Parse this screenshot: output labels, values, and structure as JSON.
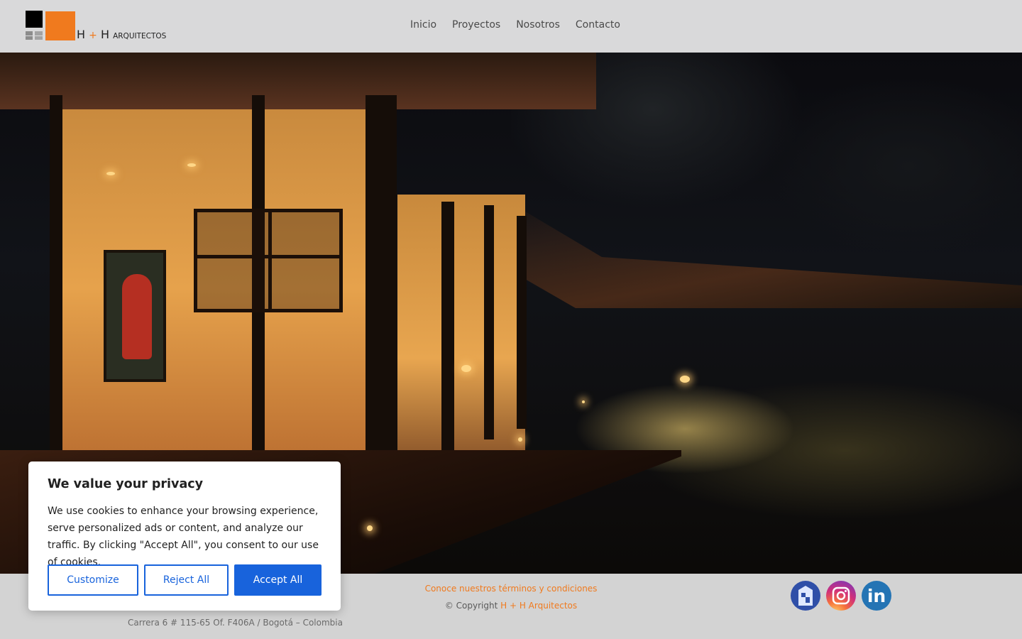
{
  "brand": {
    "logo_main": "H",
    "logo_plus": "+",
    "logo_second": "H",
    "logo_sub": "ARQUITECTOS",
    "accent_color": "#f07a1e"
  },
  "nav": {
    "items": [
      {
        "label": "Inicio"
      },
      {
        "label": "Proyectos"
      },
      {
        "label": "Nosotros"
      },
      {
        "label": "Contacto"
      }
    ]
  },
  "hero": {
    "image_icon": "house-at-night-photo"
  },
  "footer": {
    "terms_link": "Conoce nuestros términos y condiciones",
    "copyright_prefix": "© Copyright",
    "copyright_brand": "H + H Arquitectos",
    "address": "Carrera 6 # 115-65 Of. F406A / Bogotá – Colombia",
    "social": [
      {
        "icon": "houzz-icon"
      },
      {
        "icon": "instagram-icon"
      },
      {
        "icon": "linkedin-icon",
        "glyph": "in"
      }
    ]
  },
  "cookie_banner": {
    "title": "We value your privacy",
    "body": "We use cookies to enhance your browsing experience, serve personalized ads or content, and analyze our traffic. By clicking \"Accept All\", you consent to our use of cookies.",
    "customize_label": "Customize",
    "reject_label": "Reject All",
    "accept_label": "Accept All",
    "button_color": "#1863dc"
  }
}
